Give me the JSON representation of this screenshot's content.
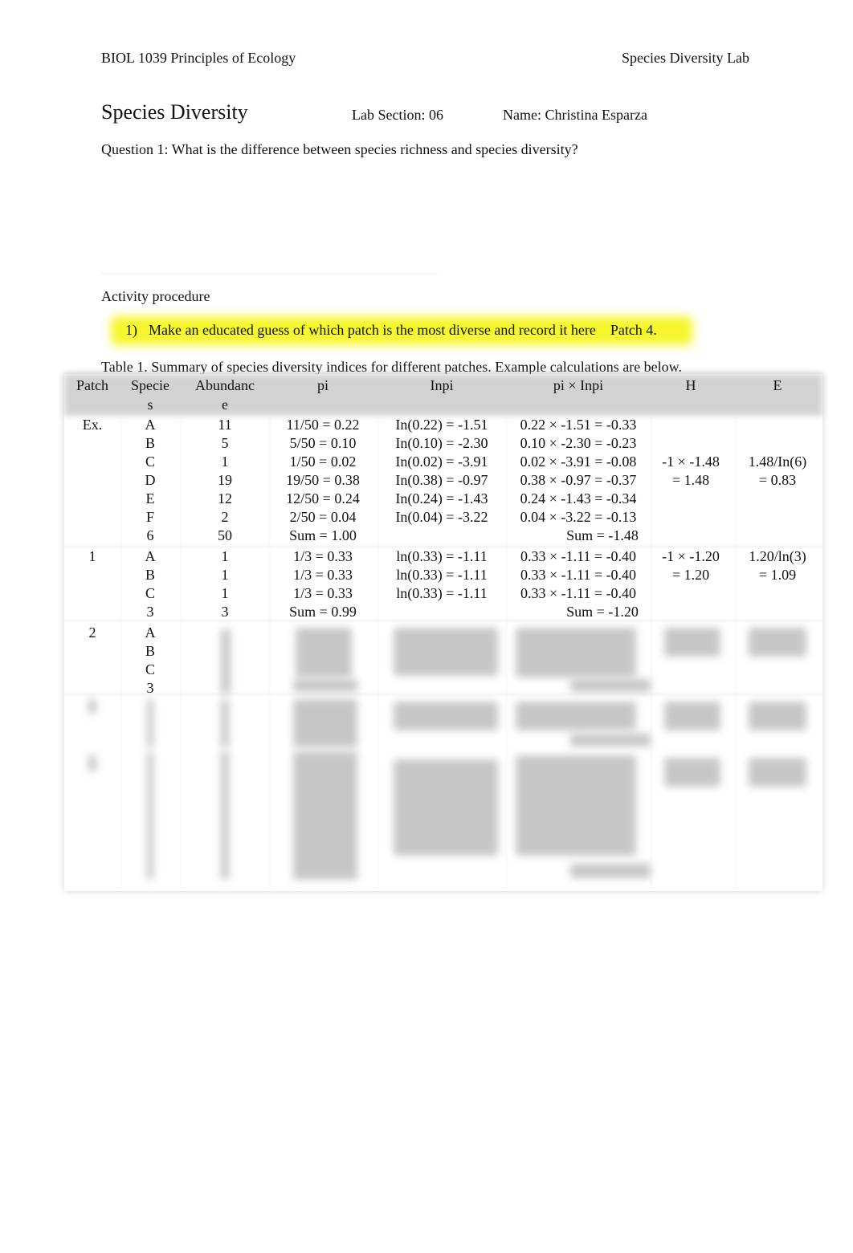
{
  "header": {
    "course": "BIOL 1039 Principles of Ecology",
    "lab": "Species Diversity Lab"
  },
  "title": "Species Diversity",
  "lab_section": "Lab Section: 06",
  "name": "Name: Christina Esparza",
  "question1": "Question 1: What is the difference between species richness and species diversity?",
  "activity_heading": "Activity procedure",
  "step1": {
    "number": "1)",
    "text": "Make an educated guess of which patch is the most diverse and record it here",
    "answer": "Patch 4.",
    "highlight_color": "#f6f62a"
  },
  "table_caption": "Table 1. Summary of species diversity indices for different patches. Example calculations are below.",
  "table": {
    "columns": [
      "Patch",
      "Specie\ns",
      "Abundanc\ne",
      "pi",
      "Inpi",
      "pi × Inpi",
      "H",
      "E"
    ],
    "example": {
      "patch": "Ex.",
      "rows": [
        {
          "species": "A",
          "abundance": "11",
          "pi": "11/50 = 0.22",
          "lnpi": "In(0.22) = -1.51",
          "pilnpi": "0.22 × -1.51 = -0.33"
        },
        {
          "species": "B",
          "abundance": "5",
          "pi": "5/50 = 0.10",
          "lnpi": "In(0.10) = -2.30",
          "pilnpi": "0.10 × -2.30 = -0.23"
        },
        {
          "species": "C",
          "abundance": "1",
          "pi": "1/50 = 0.02",
          "lnpi": "In(0.02) = -3.91",
          "pilnpi": "0.02 × -3.91 = -0.08"
        },
        {
          "species": "D",
          "abundance": "19",
          "pi": "19/50 = 0.38",
          "lnpi": "In(0.38) = -0.97",
          "pilnpi": "0.38 × -0.97 = -0.37"
        },
        {
          "species": "E",
          "abundance": "12",
          "pi": "12/50 = 0.24",
          "lnpi": "In(0.24) = -1.43",
          "pilnpi": "0.24 × -1.43 = -0.34"
        },
        {
          "species": "F",
          "abundance": "2",
          "pi": "2/50 = 0.04",
          "lnpi": "In(0.04) = -3.22",
          "pilnpi": "0.04 × -3.22 = -0.13"
        }
      ],
      "total": {
        "species": "6",
        "abundance": "50",
        "pi": "Sum = 1.00",
        "pilnpi": "Sum = -1.48"
      },
      "H": [
        "-1 × -1.48",
        "= 1.48"
      ],
      "E": [
        "1.48/In(6)",
        "= 0.83"
      ]
    },
    "patch1": {
      "patch": "1",
      "rows": [
        {
          "species": "A",
          "abundance": "1",
          "pi": "1/3 = 0.33",
          "lnpi": "ln(0.33) = -1.11",
          "pilnpi": "0.33 × -1.11 = -0.40"
        },
        {
          "species": "B",
          "abundance": "1",
          "pi": "1/3 = 0.33",
          "lnpi": "ln(0.33) = -1.11",
          "pilnpi": "0.33 × -1.11 = -0.40"
        },
        {
          "species": "C",
          "abundance": "1",
          "pi": "1/3 = 0.33",
          "lnpi": "ln(0.33) = -1.11",
          "pilnpi": "0.33 × -1.11 = -0.40"
        }
      ],
      "total": {
        "species": "3",
        "abundance": "3",
        "pi": "Sum = 0.99",
        "pilnpi": "Sum = -1.20"
      },
      "H": [
        "-1 × -1.20",
        "= 1.20"
      ],
      "E": [
        "1.20/ln(3)",
        "= 1.09"
      ]
    },
    "patch2": {
      "patch": "2",
      "species": [
        "A",
        "B",
        "C",
        "3"
      ]
    }
  }
}
